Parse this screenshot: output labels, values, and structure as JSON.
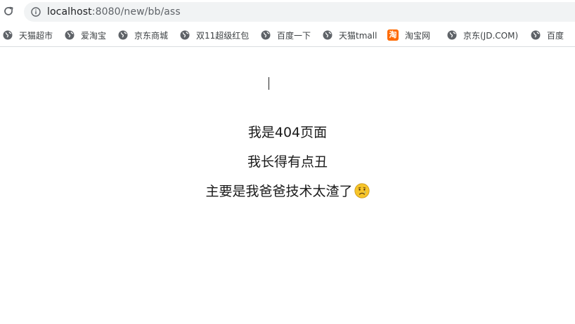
{
  "toolbar": {
    "url_host": "localhost",
    "url_rest": ":8080/new/bb/ass"
  },
  "bookmarks": [
    {
      "label": "天猫超市",
      "icon": "globe-icon"
    },
    {
      "label": "爱淘宝",
      "icon": "globe-icon"
    },
    {
      "label": "京东商城",
      "icon": "globe-icon"
    },
    {
      "label": "双11超级红包",
      "icon": "globe-icon"
    },
    {
      "label": "百度一下",
      "icon": "globe-icon"
    },
    {
      "label": "天猫tmall",
      "icon": "globe-icon"
    },
    {
      "label": "淘宝网",
      "icon": "taobao-icon",
      "icon_text": "淘"
    },
    {
      "label": "京东(JD.COM)",
      "icon": "globe-icon"
    },
    {
      "label": "百度",
      "icon": "globe-icon"
    }
  ],
  "page": {
    "line1": "我是404页面",
    "line2": "我长得有点丑",
    "line3": "主要是我爸爸技术太渣了",
    "emoji": "crying-face-emoji"
  },
  "colors": {
    "omnibox_bg": "#f1f3f4",
    "taobao_orange": "#ff6a00",
    "emoji_yellow": "#f7c52a"
  }
}
